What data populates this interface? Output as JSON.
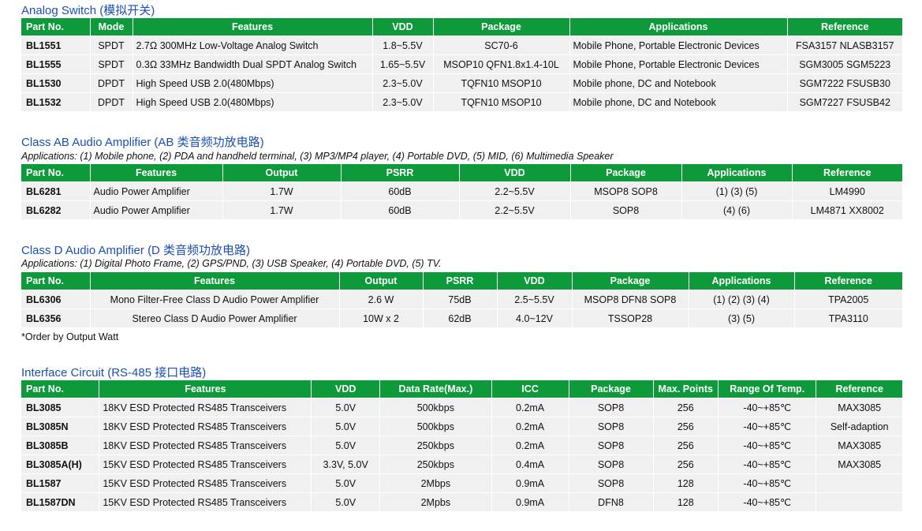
{
  "analog": {
    "title": "Analog Switch (模拟开关)",
    "headers": [
      "Part No.",
      "Mode",
      "Features",
      "VDD",
      "Package",
      "Applications",
      "Reference"
    ],
    "rows": [
      [
        "BL1551",
        "SPDT",
        "2.7Ω 300MHz Low-Voltage Analog Switch",
        "1.8~5.5V",
        "SC70-6",
        "Mobile Phone, Portable Electronic Devices",
        "FSA3157 NLASB3157"
      ],
      [
        "BL1555",
        "SPDT",
        "0.3Ω 33MHz Bandwidth Dual SPDT Analog Switch",
        "1.65~5.5V",
        "MSOP10 QFN1.8x1.4-10L",
        "Mobile Phone, Portable Electronic Devices",
        "SGM3005 SGM5223"
      ],
      [
        "BL1530",
        "DPDT",
        "High Speed USB 2.0(480Mbps)",
        "2.3~5.0V",
        "TQFN10 MSOP10",
        "Mobile phone, DC and Notebook",
        "SGM7222 FSUSB30"
      ],
      [
        "BL1532",
        "DPDT",
        "High Speed USB 2.0(480Mbps)",
        "2.3~5.0V",
        "TQFN10 MSOP10",
        "Mobile phone, DC and Notebook",
        "SGM7227 FSUSB42"
      ]
    ]
  },
  "class_ab": {
    "title": "Class AB Audio Amplifier (AB 类音频功放电路)",
    "apps": "Applications: (1) Mobile phone, (2) PDA and handheld terminal, (3) MP3/MP4 player, (4) Portable DVD, (5) MID, (6) Multimedia Speaker",
    "headers": [
      "Part No.",
      "Features",
      "Output",
      "PSRR",
      "VDD",
      "Package",
      "Applications",
      "Reference"
    ],
    "rows": [
      [
        "BL6281",
        "Audio Power Amplifier",
        "1.7W",
        "60dB",
        "2.2~5.5V",
        "MSOP8 SOP8",
        "(1) (3) (5)",
        "LM4990"
      ],
      [
        "BL6282",
        "Audio Power Amplifier",
        "1.7W",
        "60dB",
        "2.2~5.5V",
        "SOP8",
        "(4) (6)",
        "LM4871 XX8002"
      ]
    ]
  },
  "class_d": {
    "title": "Class D Audio Amplifier (D 类音频功放电路)",
    "apps": "Applications: (1) Digital Photo Frame, (2) GPS/PND, (3) USB Speaker, (4) Portable DVD, (5) TV.",
    "headers": [
      "Part No.",
      "Features",
      "Output",
      "PSRR",
      "VDD",
      "Package",
      "Applications",
      "Reference"
    ],
    "rows": [
      [
        "BL6306",
        "Mono Filter-Free Class D Audio Power Amplifier",
        "2.6 W",
        "75dB",
        "2.5~5.5V",
        "MSOP8 DFN8 SOP8",
        "(1) (2) (3) (4)",
        "TPA2005"
      ],
      [
        "BL6356",
        "Stereo Class D Audio Power Amplifier",
        "10W x 2",
        "62dB",
        "4.0~12V",
        "TSSOP28",
        "(3) (5)",
        "TPA3110"
      ]
    ],
    "note": "*Order by Output Watt"
  },
  "interface": {
    "title": "Interface Circuit (RS-485 接口电路)",
    "headers": [
      "Part No.",
      "Features",
      "VDD",
      "Data Rate(Max.)",
      "ICC",
      "Package",
      "Max. Points",
      "Range Of Temp.",
      "Reference"
    ],
    "rows": [
      [
        "BL3085",
        "18KV ESD Protected RS485 Transceivers",
        "5.0V",
        "500kbps",
        "0.2mA",
        "SOP8",
        "256",
        "-40~+85℃",
        "MAX3085"
      ],
      [
        "BL3085N",
        "18KV ESD Protected RS485 Transceivers",
        "5.0V",
        "500kbps",
        "0.2mA",
        "SOP8",
        "256",
        "-40~+85℃",
        "Self-adaption"
      ],
      [
        "BL3085B",
        "18KV ESD Protected RS485 Transceivers",
        "5.0V",
        "250kbps",
        "0.2mA",
        "SOP8",
        "256",
        "-40~+85℃",
        "MAX3085"
      ],
      [
        "BL3085A(H)",
        "15KV ESD Protected RS485 Transceivers",
        "3.3V, 5.0V",
        "250kbps",
        "0.4mA",
        "SOP8",
        "256",
        "-40~+85℃",
        "MAX3085"
      ],
      [
        "BL1587",
        "15KV ESD Protected RS485 Transceivers",
        "5.0V",
        "2Mbps",
        "0.9mA",
        "SOP8",
        "128",
        "-40~+85℃",
        ""
      ],
      [
        "BL1587DN",
        "15KV ESD Protected RS485 Transceivers",
        "5.0V",
        "2Mpbs",
        "0.9mA",
        "DFN8",
        "128",
        "-40~+85℃",
        ""
      ]
    ]
  }
}
